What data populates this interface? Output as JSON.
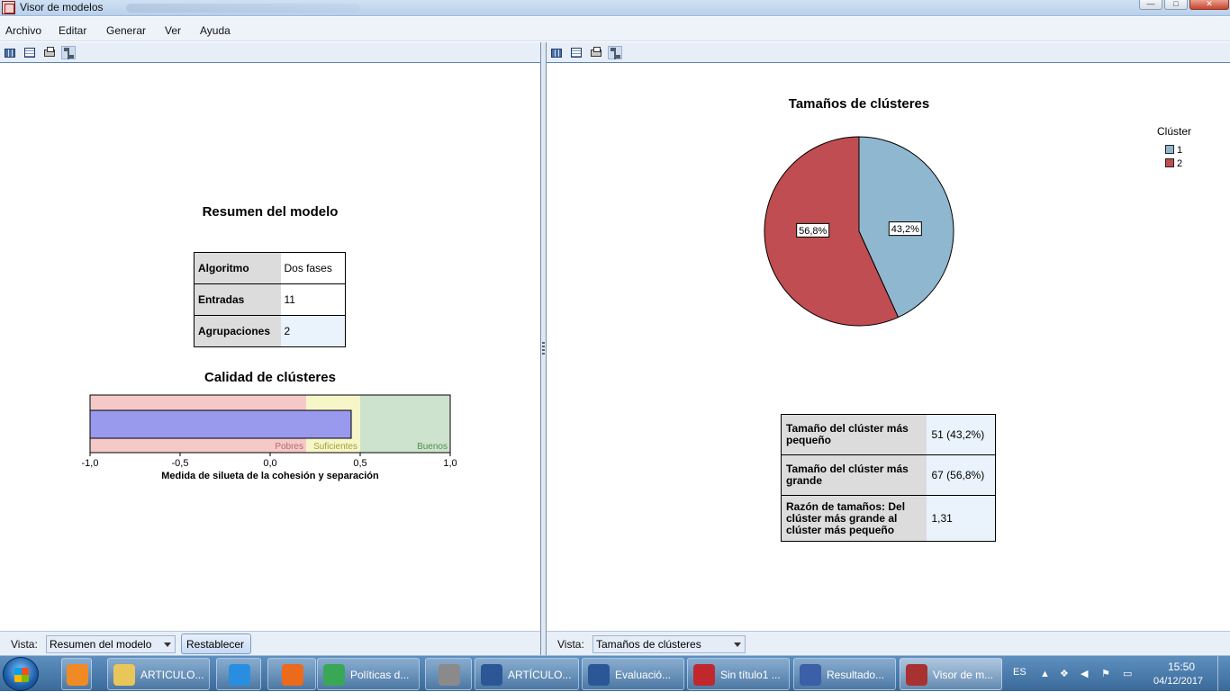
{
  "window": {
    "title": "Visor de modelos",
    "buttons": {
      "minimize": "—",
      "maximize": "□",
      "close": "✕"
    }
  },
  "menu": [
    "Archivo",
    "Editar",
    "Generar",
    "Ver",
    "Ayuda"
  ],
  "left_pane": {
    "summary_title": "Resumen del modelo",
    "summary_table": [
      {
        "key": "Algoritmo",
        "value": "Dos fases"
      },
      {
        "key": "Entradas",
        "value": "11"
      },
      {
        "key": "Agrupaciones",
        "value": "2"
      }
    ],
    "quality_title": "Calidad de clústeres",
    "vista_label": "Vista:",
    "vista_value": "Resumen del modelo",
    "reset_button": "Restablecer"
  },
  "right_pane": {
    "sizes_title": "Tamaños de clústeres",
    "legend_title": "Clúster",
    "sizes_table": [
      {
        "key": "Tamaño del clúster más pequeño",
        "value": "51 (43,2%)"
      },
      {
        "key": "Tamaño del clúster más grande",
        "value": "67 (56,8%)"
      },
      {
        "key": "Razón de tamaños: Del clúster más grande al clúster más pequeño",
        "value": "1,31"
      }
    ],
    "vista_label": "Vista:",
    "vista_value": "Tamaños de clústeres"
  },
  "chart_data": [
    {
      "type": "bar",
      "title": "Calidad de clústeres",
      "xlabel": "Medida de silueta de la cohesión y separación",
      "xlim": [
        -1.0,
        1.0
      ],
      "ticks": [
        "-1,0",
        "-0,5",
        "0,0",
        "0,5",
        "1,0"
      ],
      "value": 0.45,
      "bands": [
        {
          "label": "Pobres",
          "from": -1.0,
          "to": 0.2,
          "color": "#f6c9c9"
        },
        {
          "label": "Suficientes",
          "from": 0.2,
          "to": 0.5,
          "color": "#f7f6c8"
        },
        {
          "label": "Buenos",
          "from": 0.5,
          "to": 1.0,
          "color": "#cde3cd"
        }
      ],
      "bar_color": "#9999ee"
    },
    {
      "type": "pie",
      "title": "Tamaños de clústeres",
      "legend_title": "Clúster",
      "legend_position": "top-right",
      "slices": [
        {
          "label": "1",
          "value": 43.2,
          "text": "43,2%",
          "color": "#8fb8d0"
        },
        {
          "label": "2",
          "value": 56.8,
          "text": "56,8%",
          "color": "#c04d51"
        }
      ]
    }
  ],
  "taskbar": {
    "items": [
      {
        "label": "",
        "icon": "media-player-icon",
        "color": "#f08a24"
      },
      {
        "label": "ARTICULO...",
        "icon": "folder-icon",
        "color": "#e8c65a"
      },
      {
        "label": "",
        "icon": "internet-explorer-icon",
        "color": "#2a8ee0"
      },
      {
        "label": "",
        "icon": "firefox-icon",
        "color": "#ec6a1c"
      },
      {
        "label": "Políticas d...",
        "icon": "chrome-icon",
        "color": "#3aa757"
      },
      {
        "label": "",
        "icon": "vs-icon",
        "color": "#8a8a8a"
      },
      {
        "label": "ARTÍCULO...",
        "icon": "word-icon",
        "color": "#2b5797"
      },
      {
        "label": "Evaluació...",
        "icon": "word-icon",
        "color": "#2b5797"
      },
      {
        "label": "Sin título1 ...",
        "icon": "spss-data-icon",
        "color": "#c0282d"
      },
      {
        "label": "Resultado...",
        "icon": "spss-output-icon",
        "color": "#3c5fa8"
      },
      {
        "label": "Visor de m...",
        "icon": "model-viewer-icon",
        "color": "#a83232"
      }
    ],
    "language": "ES",
    "time": "15:50",
    "date": "04/12/2017"
  }
}
